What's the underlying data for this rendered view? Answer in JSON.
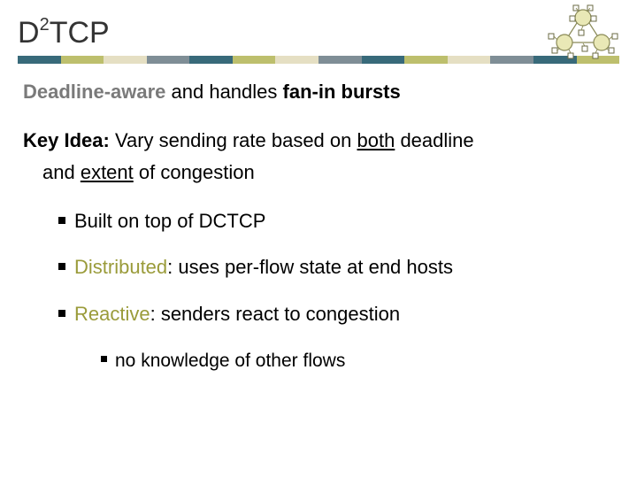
{
  "title": {
    "prefix": "D",
    "sup": "2",
    "suffix": "TCP"
  },
  "line1": {
    "label_deadline": "Deadline-aware",
    "mid": " and handles ",
    "label_fanin": "fan-in bursts"
  },
  "line2": {
    "key": "Key Idea:",
    "tail1": " Vary sending rate based on ",
    "both": "both",
    "tail2": " deadline",
    "cont_pre": "and ",
    "extent": "extent",
    "cont_post": " of congestion"
  },
  "bullets": {
    "b1": "Built on top of DCTCP",
    "b2": {
      "label": "Distributed",
      "rest": ": uses per-flow state at end hosts"
    },
    "b3": {
      "label": "Reactive",
      "rest": ": senders react to congestion"
    },
    "sub1": "no knowledge of other flows"
  },
  "stripe_colors": [
    "#386a7a",
    "#bdbf6d",
    "#e5dfc3",
    "#7f8e96",
    "#386a7a",
    "#bdbf6d",
    "#e5dfc3",
    "#7f8e96",
    "#386a7a",
    "#bdbf6d",
    "#e5dfc3",
    "#7f8e96",
    "#386a7a",
    "#bdbf6d"
  ]
}
